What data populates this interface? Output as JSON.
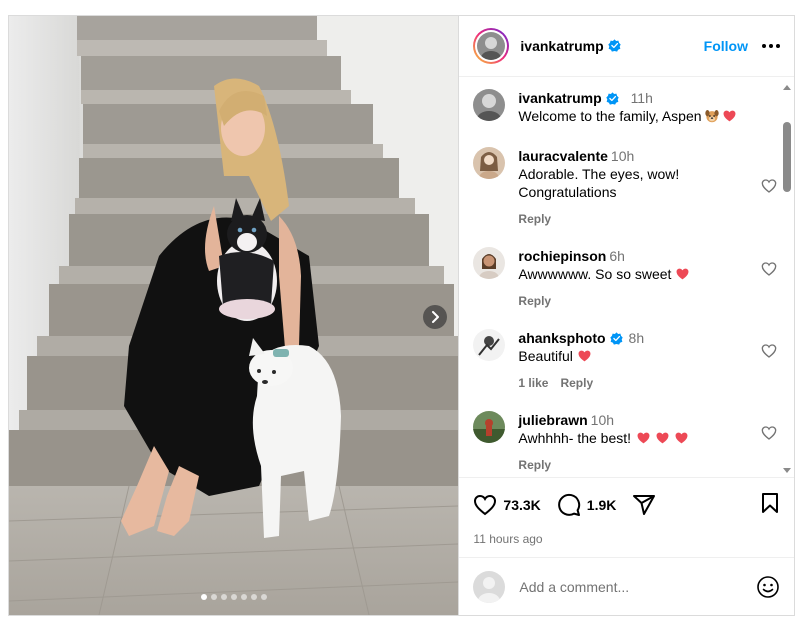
{
  "post": {
    "author": "ivankatrump",
    "follow_label": "Follow",
    "slide_count": 7,
    "active_slide": 0
  },
  "caption": {
    "username": "ivankatrump",
    "time": "11h",
    "text": "Welcome to the family, Aspen",
    "emojis": [
      "dog-face",
      "red-heart"
    ]
  },
  "comments": [
    {
      "username": "lauracvalente",
      "verified": false,
      "time": "10h",
      "text": "Adorable. The eyes, wow! Congratulations",
      "hearts": 0,
      "likes": "",
      "reply_label": "Reply"
    },
    {
      "username": "rochiepinson",
      "verified": false,
      "time": "6h",
      "text": "Awwwwww. So so sweet",
      "hearts": 1,
      "likes": "",
      "reply_label": "Reply"
    },
    {
      "username": "ahanksphoto",
      "verified": true,
      "time": "8h",
      "text": "Beautiful",
      "hearts": 1,
      "likes": "1 like",
      "reply_label": "Reply"
    },
    {
      "username": "juliebrawn",
      "verified": false,
      "time": "10h",
      "text": "Awhhhh- the best!",
      "hearts": 3,
      "likes": "",
      "reply_label": "Reply"
    }
  ],
  "stats": {
    "likes": "73.3K",
    "comments": "1.9K",
    "posted": "11 hours ago"
  },
  "add_comment": {
    "placeholder": "Add a comment..."
  },
  "colors": {
    "accent": "#0095f6",
    "secondary_text": "#737373",
    "heart_emoji": "#ed4956",
    "border": "#dbdbdb"
  },
  "icons": [
    "verified-badge",
    "more-icon",
    "heart-icon",
    "comment-icon",
    "share-icon",
    "bookmark-icon",
    "emoji-icon",
    "chevron-right-icon"
  ]
}
